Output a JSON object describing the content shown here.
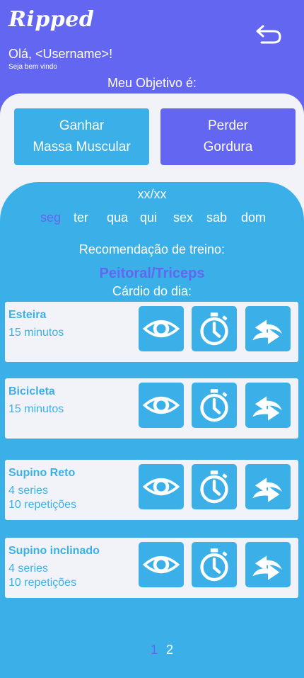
{
  "header": {
    "logo": "Ripped",
    "greeting": "Olá, <Username>!",
    "welcome": "Seja bem vindo",
    "goal_title": "Meu Objetivo é:"
  },
  "goals": {
    "gain": {
      "line1": "Ganhar",
      "line2": "Massa Muscular"
    },
    "lose": {
      "line1": "Perder",
      "line2": "Gordura"
    }
  },
  "schedule": {
    "date": "xx/xx",
    "days": [
      "seg",
      "ter",
      "qua",
      "qui",
      "sex",
      "sab",
      "dom"
    ],
    "selected_day": "seg"
  },
  "recommendation": {
    "title": "Recomendação de treino:",
    "workout": "Peitoral/Triceps",
    "cardio_title": "Cárdio do dia:"
  },
  "exercises": [
    {
      "name": "Esteira",
      "line1": "15 minutos",
      "line2": ""
    },
    {
      "name": "Bicicleta",
      "line1": "15 minutos",
      "line2": ""
    },
    {
      "name": "Supino Reto",
      "line1": "4 series",
      "line2": "10 repetições"
    },
    {
      "name": "Supino inclinado",
      "line1": "4 series",
      "line2": "10 repetições"
    }
  ],
  "pagination": {
    "current": "1",
    "next": "2"
  },
  "icons": {
    "back": "back-arrow-icon",
    "view": "eye-icon",
    "timer": "stopwatch-icon",
    "swap": "swap-arrows-icon"
  },
  "colors": {
    "primary_purple": "#6366f0",
    "primary_blue": "#3bb0e8",
    "surface": "#f2f3f8"
  }
}
